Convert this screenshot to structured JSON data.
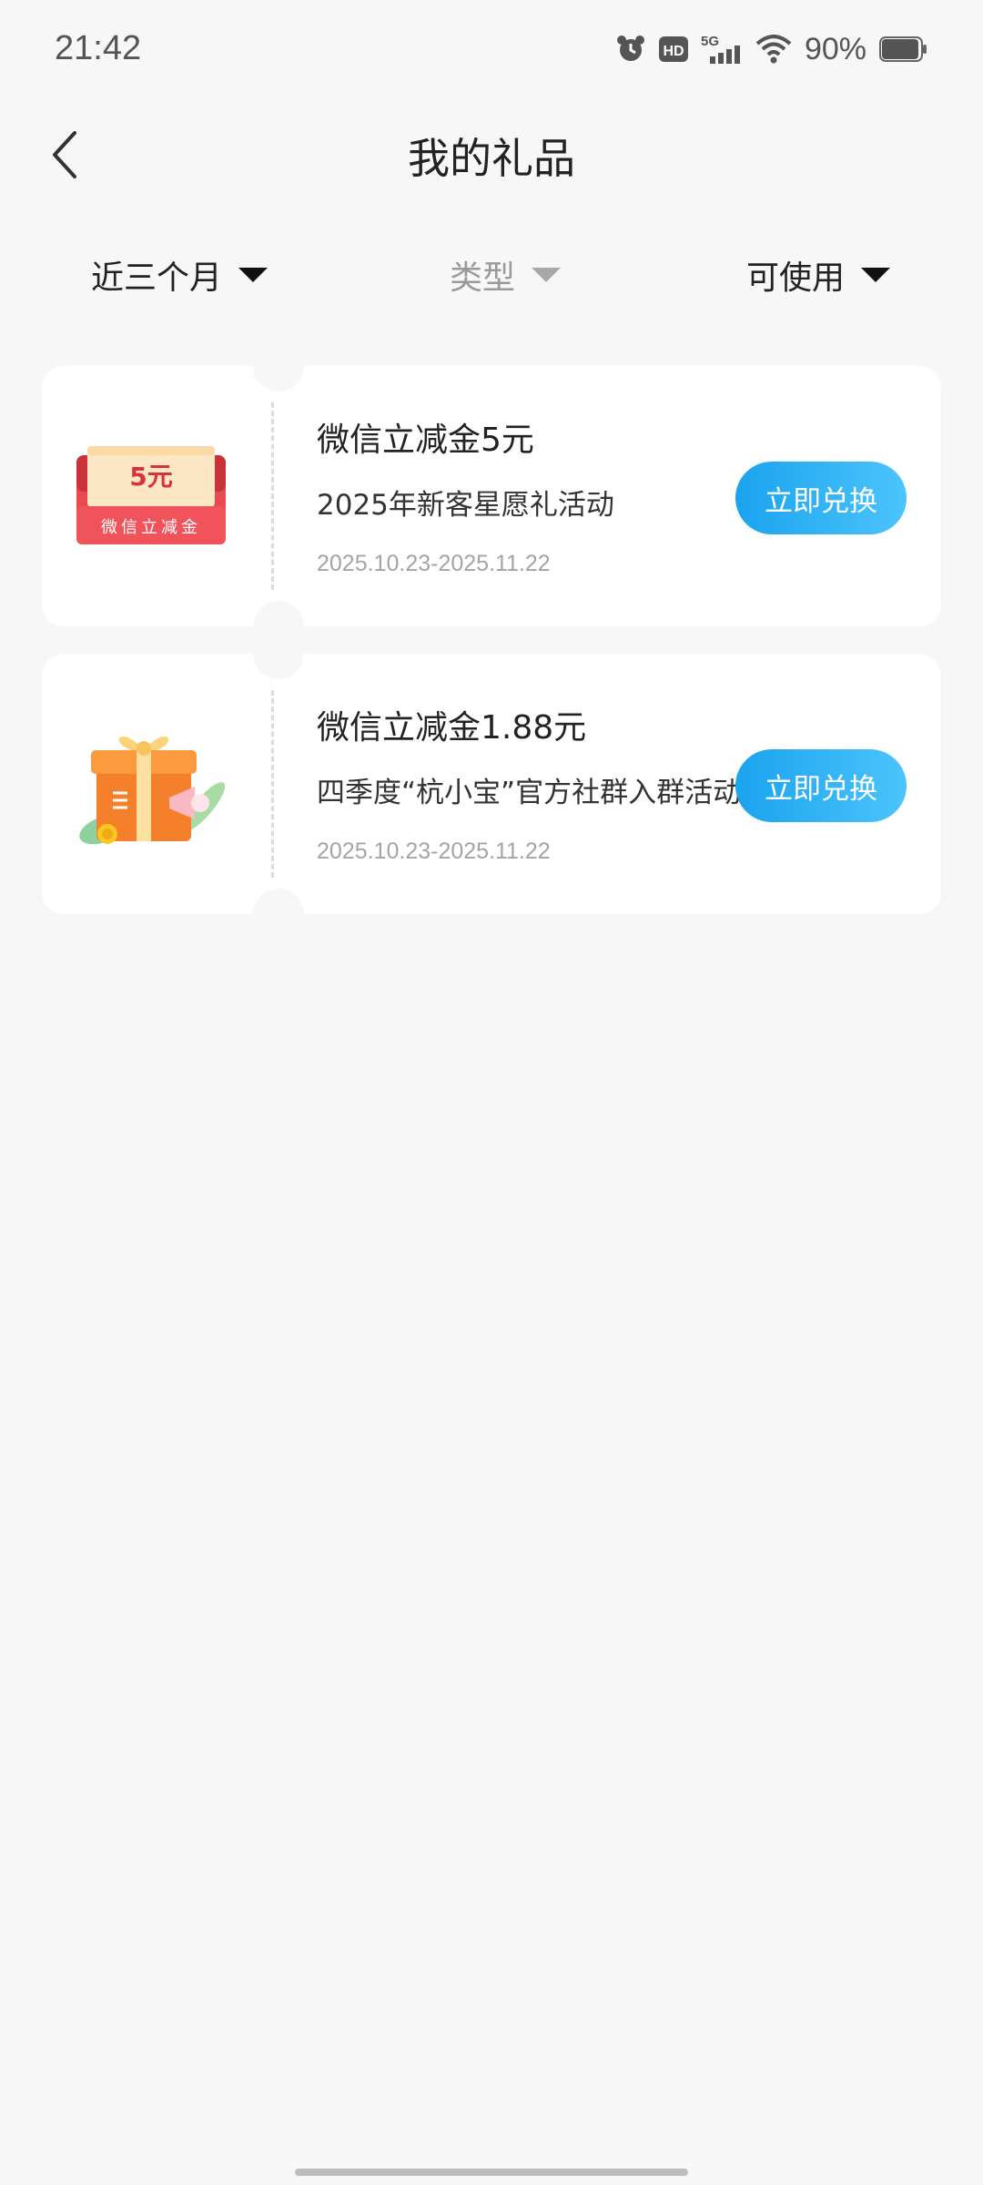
{
  "status_bar": {
    "time": "21:42",
    "network": "5G",
    "hd_badge": "HD",
    "battery_percent": "90%",
    "battery_level": 0.9,
    "icons": [
      "alarm-icon",
      "hd-icon",
      "signal-5g-icon",
      "wifi-icon",
      "battery-icon"
    ]
  },
  "header": {
    "title": "我的礼品",
    "back_icon": "chevron-left-icon"
  },
  "filters": {
    "period": "近三个月",
    "type": "类型",
    "status": "可使用"
  },
  "gifts": [
    {
      "title": "微信立减金5元",
      "desc": "2025年新客星愿礼活动",
      "date": "2025.10.23-2025.11.22",
      "button": "立即兑换",
      "image": {
        "kind": "coupon-envelope",
        "amount": "5元",
        "label": "微信立减金"
      }
    },
    {
      "title": "微信立减金1.88元",
      "desc": "四季度“杭小宝”官方社群入群活动",
      "date": "2025.10.23-2025.11.22",
      "button": "立即兑换",
      "image": {
        "kind": "gift-box"
      }
    }
  ],
  "colors": {
    "button_start": "#1aa3ef",
    "button_end": "#4cc4fb",
    "background": "#f7f7f7",
    "coupon_red": "#e84a4f"
  }
}
